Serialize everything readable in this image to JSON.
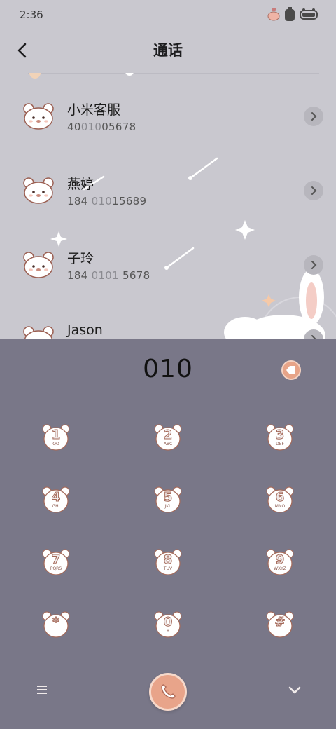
{
  "status_bar": {
    "time": "2:36",
    "icons": [
      "perfume-icon",
      "battery-bottle-icon",
      "battery-icon"
    ]
  },
  "header": {
    "title": "通话",
    "back_icon": "chevron-left-icon"
  },
  "contacts": [
    {
      "name": "小米客服",
      "number_pre": "40",
      "number_hl": "010",
      "number_post": "05678"
    },
    {
      "name": "燕婷",
      "number_pre": "184 ",
      "number_hl": "010",
      "number_post": "15689"
    },
    {
      "name": "子玲",
      "number_pre": "184 ",
      "number_hl": "0101",
      "number_post": " 5678"
    },
    {
      "name": "Jason",
      "number_pre": "",
      "number_hl": "",
      "number_post": ""
    }
  ],
  "dialer": {
    "display": "010",
    "keys": [
      {
        "digit": "1",
        "letters": "QO"
      },
      {
        "digit": "2",
        "letters": "ABC"
      },
      {
        "digit": "3",
        "letters": "DEF"
      },
      {
        "digit": "4",
        "letters": "GHI"
      },
      {
        "digit": "5",
        "letters": "JKL"
      },
      {
        "digit": "6",
        "letters": "MNO"
      },
      {
        "digit": "7",
        "letters": "PQRS"
      },
      {
        "digit": "8",
        "letters": "TUV"
      },
      {
        "digit": "9",
        "letters": "WXYZ"
      },
      {
        "digit": "*",
        "letters": ""
      },
      {
        "digit": "0",
        "letters": "+"
      },
      {
        "digit": "#",
        "letters": ""
      }
    ]
  },
  "colors": {
    "panel": "#797788",
    "accent": "#e8a48a",
    "background": "#c9c8cf"
  }
}
